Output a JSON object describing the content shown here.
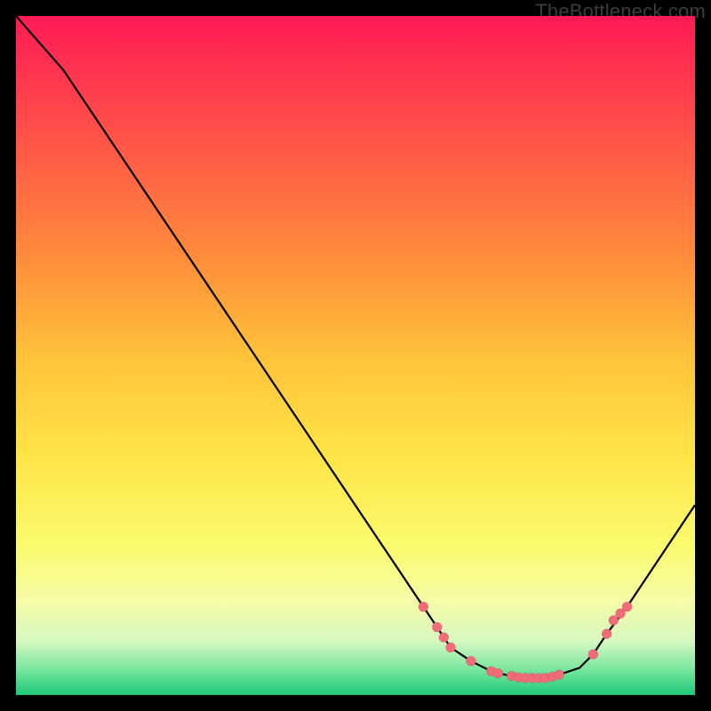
{
  "watermark": "TheBottleneck.com",
  "chart_data": {
    "type": "line",
    "title": "",
    "xlabel": "",
    "ylabel": "",
    "xlim": [
      0,
      100
    ],
    "ylim": [
      0,
      100
    ],
    "series": [
      {
        "name": "bottleneck-curve",
        "x": [
          0,
          7,
          60,
          64,
          67,
          70,
          74,
          78,
          80,
          83,
          85,
          87,
          90,
          100
        ],
        "y": [
          100,
          92,
          13,
          7,
          5,
          3.5,
          2.5,
          2.5,
          3,
          4,
          6,
          9,
          13,
          28
        ]
      }
    ],
    "markers": [
      {
        "x": 60,
        "y": 13
      },
      {
        "x": 62,
        "y": 10
      },
      {
        "x": 63,
        "y": 8.5
      },
      {
        "x": 64,
        "y": 7
      },
      {
        "x": 67,
        "y": 5
      },
      {
        "x": 70,
        "y": 3.5
      },
      {
        "x": 71,
        "y": 3.2
      },
      {
        "x": 73,
        "y": 2.8
      },
      {
        "x": 74,
        "y": 2.6
      },
      {
        "x": 75,
        "y": 2.5
      },
      {
        "x": 76,
        "y": 2.5
      },
      {
        "x": 77,
        "y": 2.5
      },
      {
        "x": 78,
        "y": 2.5
      },
      {
        "x": 79,
        "y": 2.7
      },
      {
        "x": 80,
        "y": 3
      },
      {
        "x": 85,
        "y": 6
      },
      {
        "x": 87,
        "y": 9
      },
      {
        "x": 88,
        "y": 11
      },
      {
        "x": 89,
        "y": 12
      },
      {
        "x": 90,
        "y": 13
      }
    ]
  }
}
